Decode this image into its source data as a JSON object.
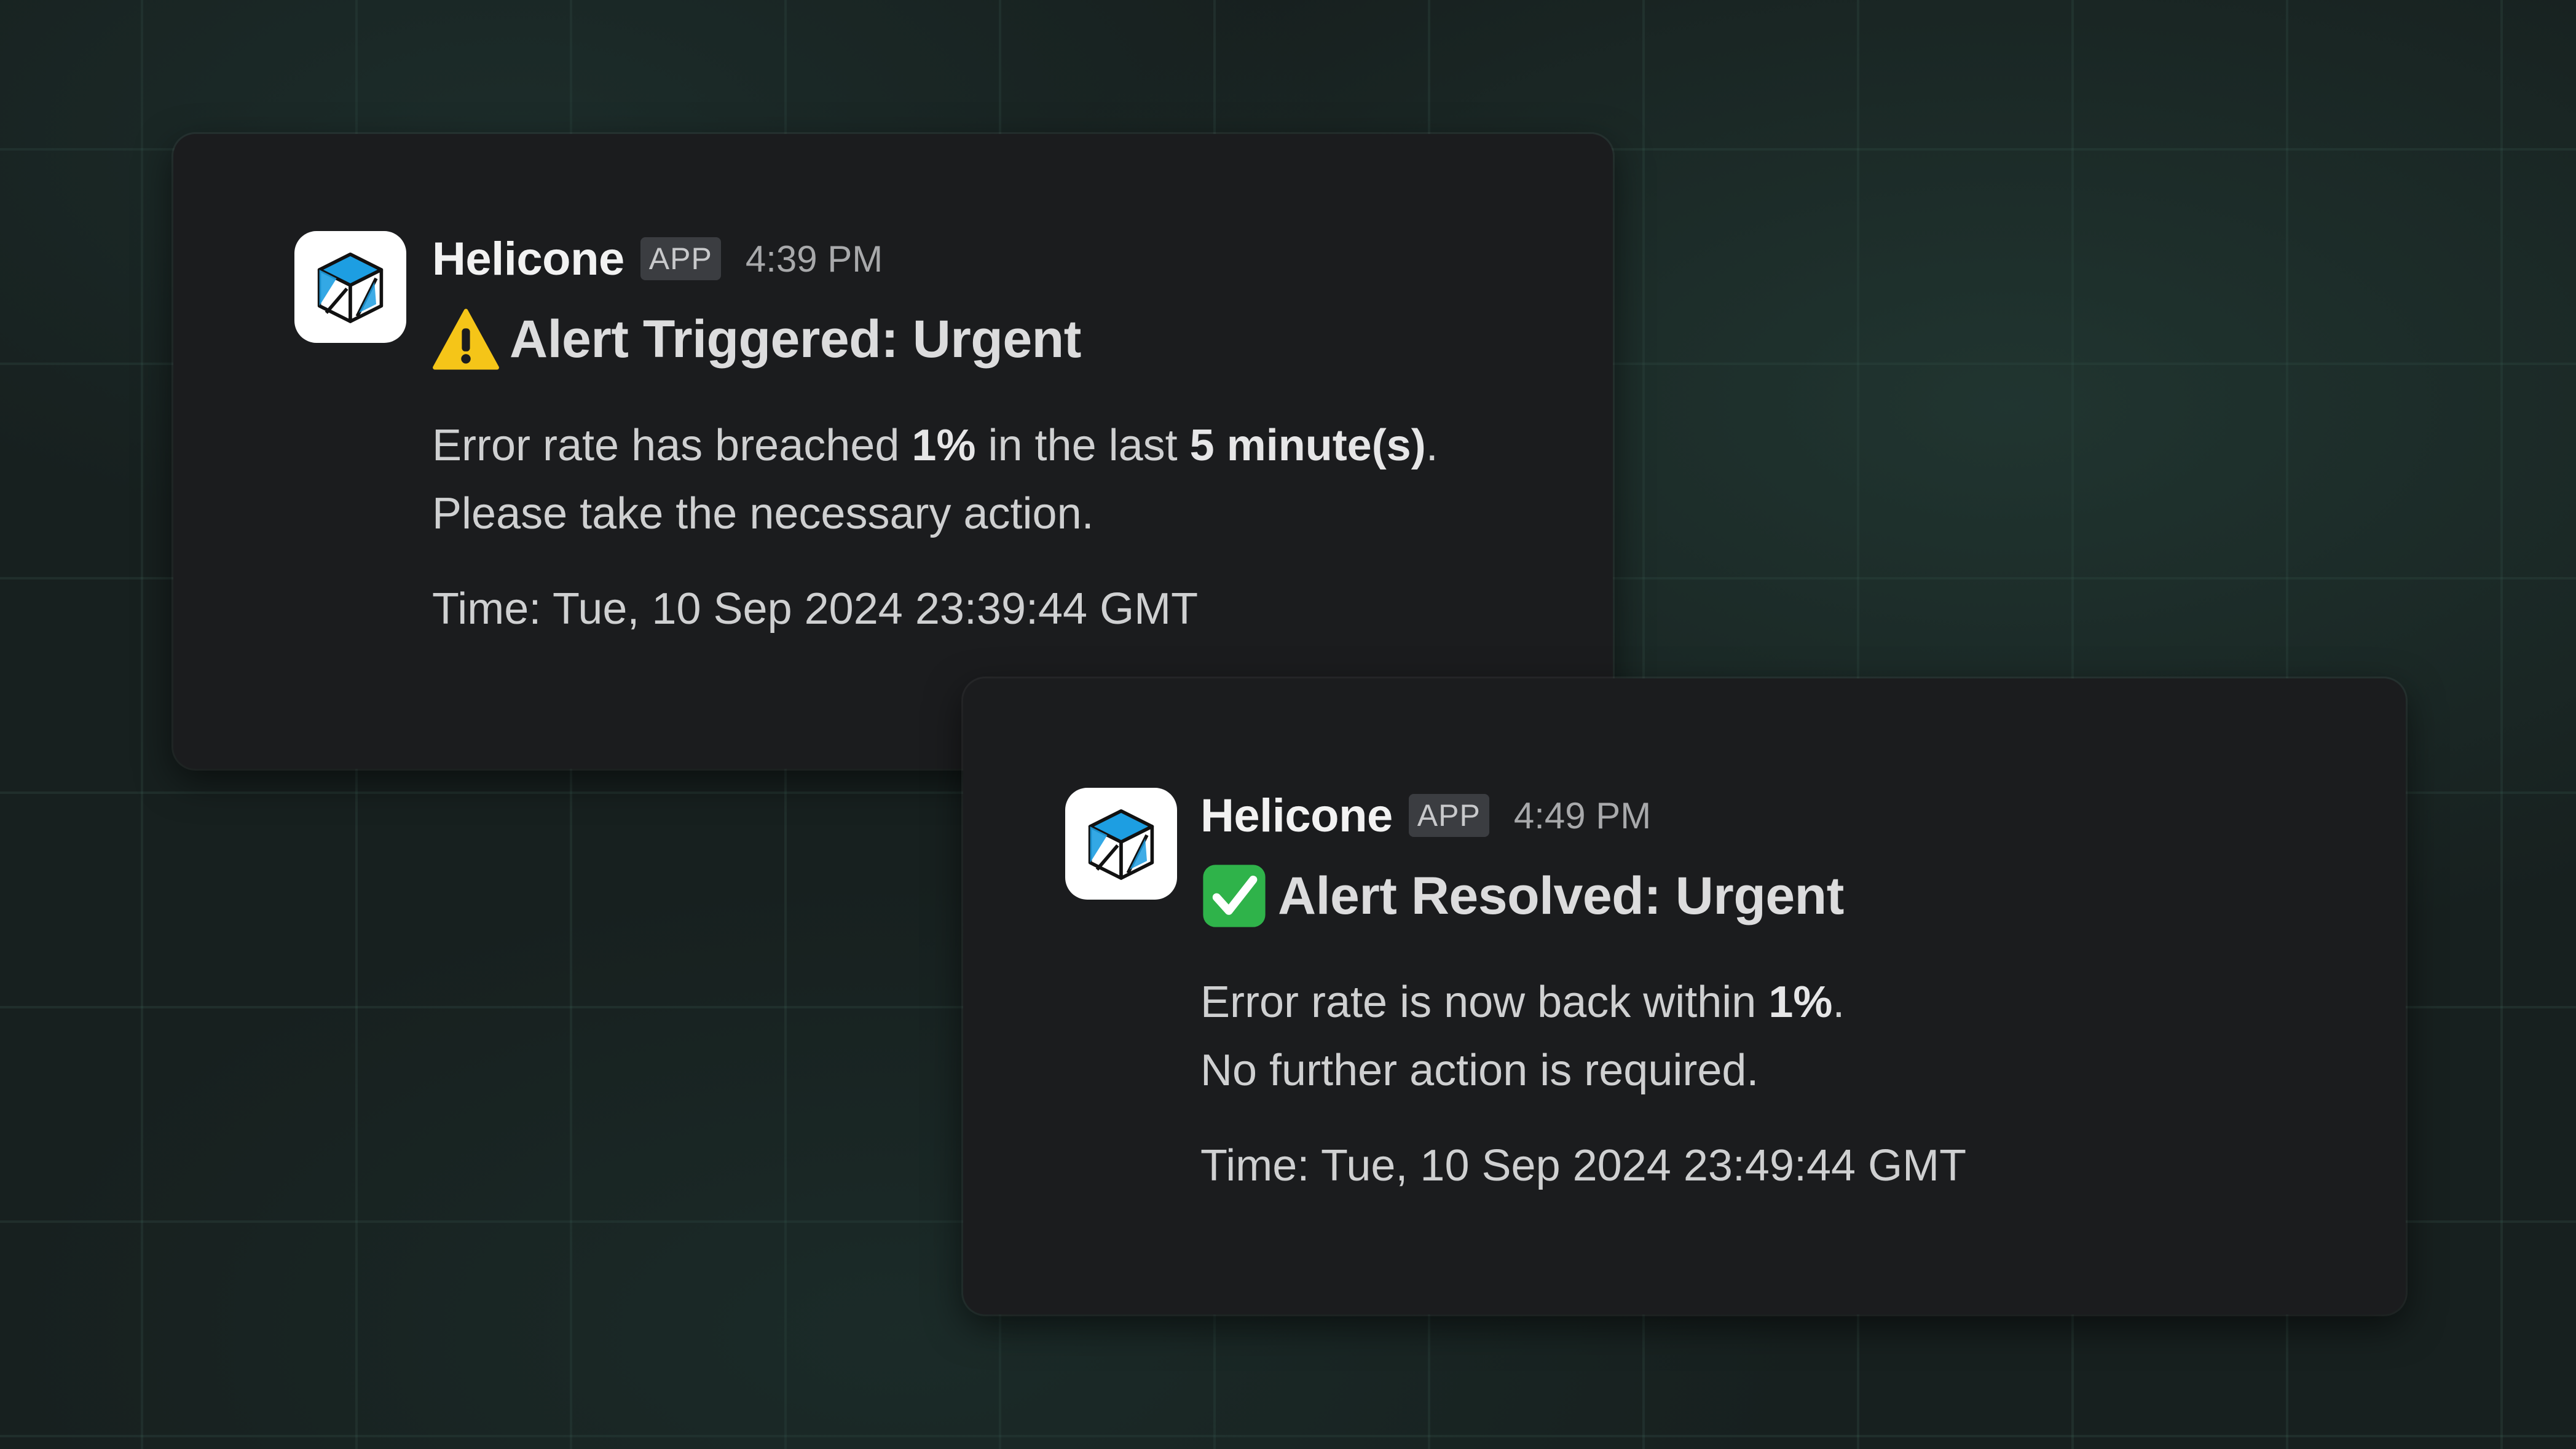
{
  "alerts": [
    {
      "sender": "Helicone",
      "badge": "APP",
      "timestamp": "4:39 PM",
      "icon": "warning-icon",
      "title": "Alert Triggered: Urgent",
      "line1_a": "Error rate has breached ",
      "line1_b": "1%",
      "line1_c": " in the last ",
      "line1_d": "5 minute(s)",
      "line1_e": ".",
      "line2": "Please take the necessary action.",
      "time": "Time: Tue, 10 Sep 2024 23:39:44 GMT"
    },
    {
      "sender": "Helicone",
      "badge": "APP",
      "timestamp": "4:49 PM",
      "icon": "check-mark-icon",
      "title": "Alert Resolved: Urgent",
      "line1_a": "Error rate is now back within ",
      "line1_b": "1%",
      "line1_c": ".",
      "line2": "No further action is required.",
      "time": "Time: Tue, 10 Sep 2024 23:49:44 GMT"
    }
  ],
  "colors": {
    "card_bg": "#1b1c1e",
    "logo_blue": "#1d9ee2",
    "warning_yellow": "#f5c518",
    "check_green": "#2fb34a"
  }
}
